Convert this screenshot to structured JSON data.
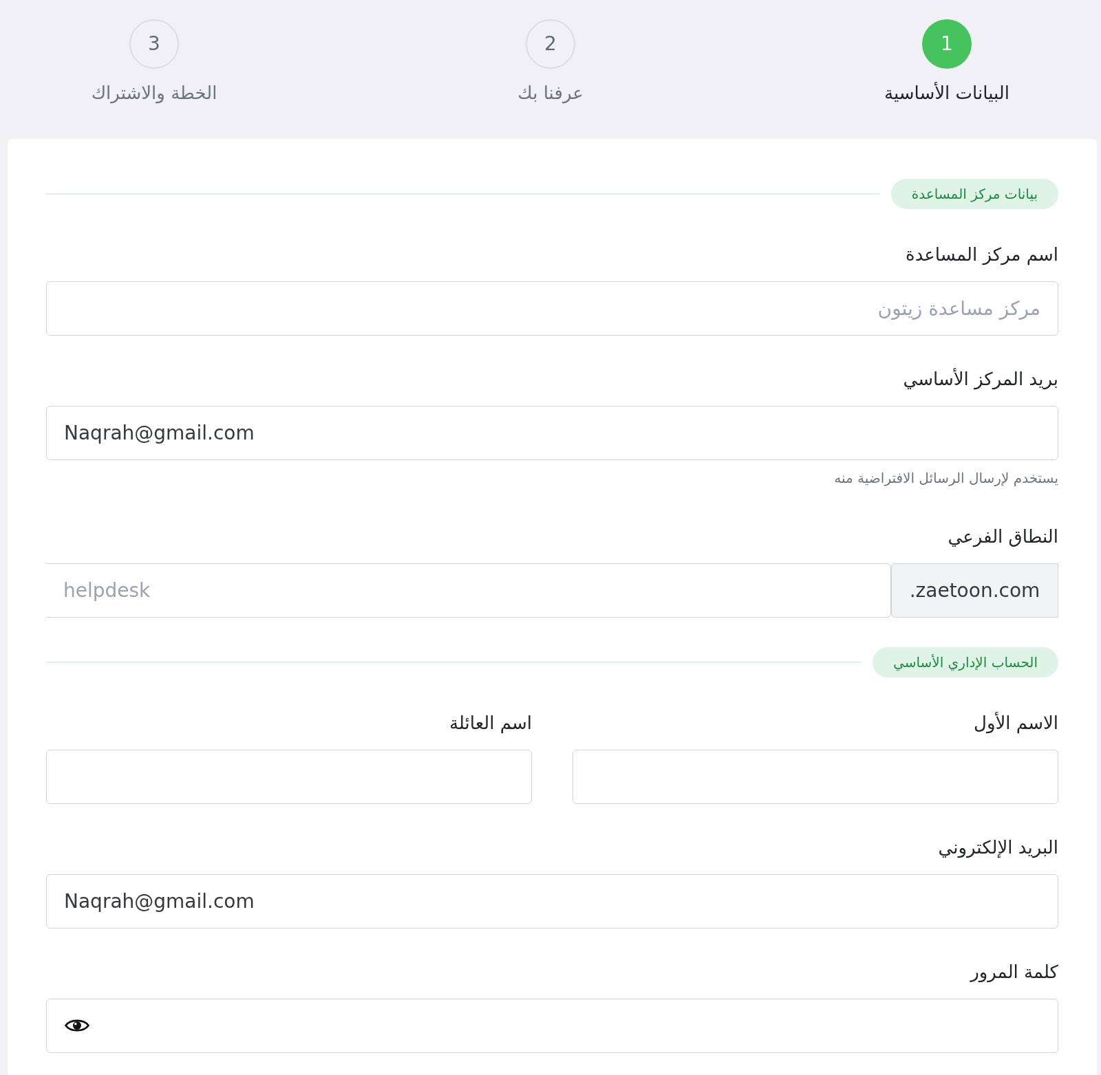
{
  "stepper": {
    "steps": [
      {
        "number": "1",
        "label": "البيانات الأساسية",
        "selected": true
      },
      {
        "number": "2",
        "label": "عرفنا بك",
        "selected": false
      },
      {
        "number": "3",
        "label": "الخطة والاشتراك",
        "selected": false
      }
    ]
  },
  "form": {
    "sections": [
      {
        "title": "بيانات مركز المساعدة",
        "fields": [
          {
            "kind": "text",
            "label": "اسم مركز المساعدة",
            "placeholder": "مركز مساعدة زيتون"
          },
          {
            "kind": "email",
            "label": "بريد المركز الأساسي",
            "value": "Naqrah@gmail.com",
            "help": "يستخدم لإرسال الرسائل الافتراضية منه"
          },
          {
            "kind": "addon",
            "label": "النطاق الفرعي",
            "placeholder": "helpdesk",
            "addon": ".zaetoon.com"
          }
        ]
      },
      {
        "title": "الحساب الإداري الأساسي",
        "fields": [
          {
            "kind": "row",
            "fields": [
              {
                "kind": "text",
                "label": "الاسم الأول"
              },
              {
                "kind": "text",
                "label": "اسم العائلة"
              }
            ]
          },
          {
            "kind": "email",
            "label": "البريد الإلكتروني",
            "value": "Naqrah@gmail.com"
          },
          {
            "kind": "password",
            "label": "كلمة المرور"
          }
        ]
      }
    ]
  }
}
